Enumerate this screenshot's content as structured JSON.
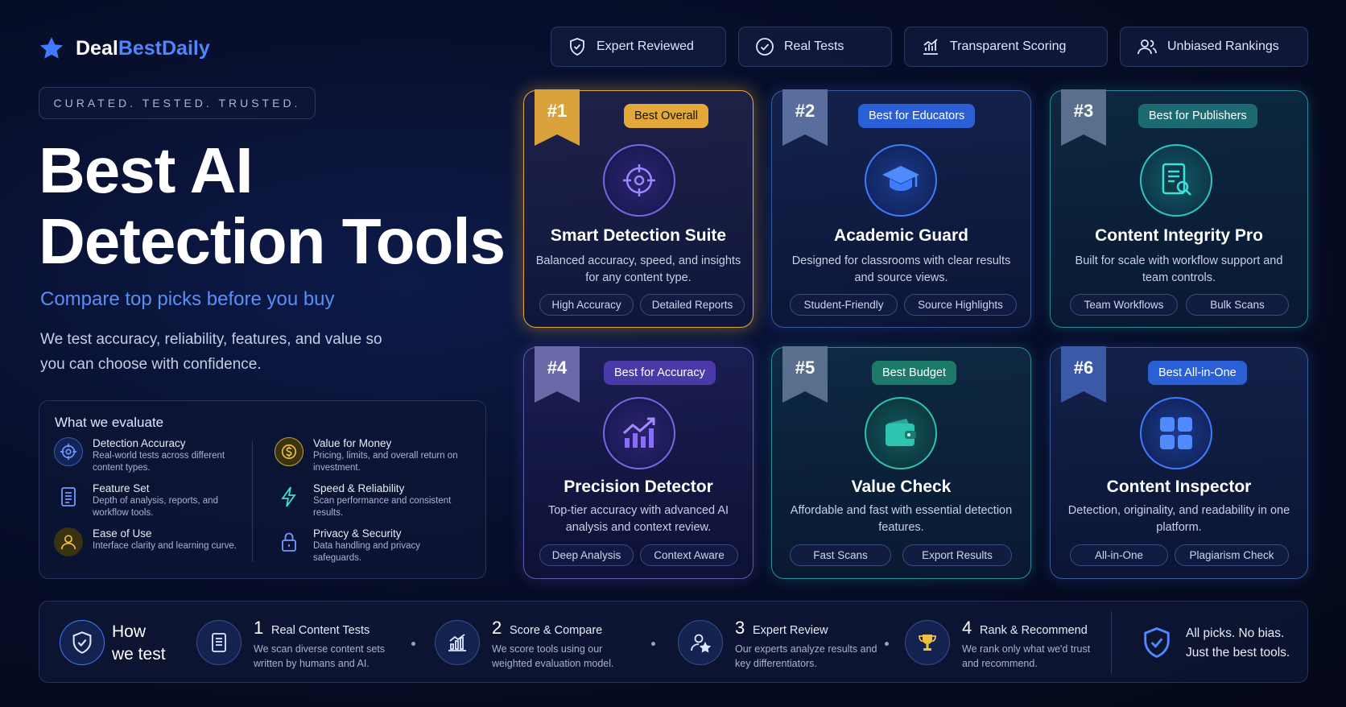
{
  "brand": {
    "name_part1": "Deal",
    "name_part2": "BestDaily",
    "icon": "star-icon"
  },
  "top_buttons": [
    {
      "label": "Expert Reviewed",
      "icon": "shield-check-icon"
    },
    {
      "label": "Real Tests",
      "icon": "check-circle-icon"
    },
    {
      "label": "Transparent Scoring",
      "icon": "bar-chart-icon"
    },
    {
      "label": "Unbiased Rankings",
      "icon": "users-icon"
    }
  ],
  "tagline": "CURATED. TESTED. TRUSTED.",
  "headline": "Best AI\nDetection Tools",
  "subheadline": "Compare top picks before you buy",
  "description": "We test accuracy, reliability, features, and value so you can choose with confidence.",
  "evaluate": {
    "title": "What we evaluate",
    "items": [
      {
        "title": "Detection Accuracy",
        "desc": "Real-world tests across different content types.",
        "icon": "target-icon"
      },
      {
        "title": "Feature Set",
        "desc": "Depth of analysis, reports, and workflow tools.",
        "icon": "document-icon"
      },
      {
        "title": "Ease of Use",
        "desc": "Interface clarity and learning curve.",
        "icon": "user-icon"
      },
      {
        "title": "Value for Money",
        "desc": "Pricing, limits, and overall return on investment.",
        "icon": "dollar-icon"
      },
      {
        "title": "Speed & Reliability",
        "desc": "Scan performance and consistent results.",
        "icon": "lightning-icon"
      },
      {
        "title": "Privacy & Security",
        "desc": "Data handling and privacy safeguards.",
        "icon": "lock-icon"
      }
    ]
  },
  "cards": [
    {
      "rank": "#1",
      "badge": "Best Overall",
      "name": "Smart Detection Suite",
      "desc": "Balanced accuracy, speed, and insights for any content type.",
      "tags": [
        "High Accuracy",
        "Detailed Reports"
      ],
      "icon": "crosshair-icon",
      "accent": "#e0a93a"
    },
    {
      "rank": "#2",
      "badge": "Best for Educators",
      "name": "Academic Guard",
      "desc": "Designed for classrooms with clear results and source views.",
      "tags": [
        "Student-Friendly",
        "Source Highlights"
      ],
      "icon": "graduation-cap-icon",
      "accent": "#3f7bff"
    },
    {
      "rank": "#3",
      "badge": "Best for Publishers",
      "name": "Content Integrity Pro",
      "desc": "Built for scale with workflow support and team controls.",
      "tags": [
        "Team Workflows",
        "Bulk Scans"
      ],
      "icon": "document-search-icon",
      "accent": "#2ec4c4"
    },
    {
      "rank": "#4",
      "badge": "Best for Accuracy",
      "name": "Precision Detector",
      "desc": "Top-tier accuracy with advanced AI analysis and context review.",
      "tags": [
        "Deep Analysis",
        "Context Aware"
      ],
      "icon": "chart-growth-icon",
      "accent": "#8a6cff"
    },
    {
      "rank": "#5",
      "badge": "Best Budget",
      "name": "Value Check",
      "desc": "Affordable and fast with essential detection features.",
      "tags": [
        "Fast Scans",
        "Export Results"
      ],
      "icon": "wallet-icon",
      "accent": "#2ec4a8"
    },
    {
      "rank": "#6",
      "badge": "Best All-in-One",
      "name": "Content Inspector",
      "desc": "Detection, originality, and readability in one platform.",
      "tags": [
        "All-in-One",
        "Plagiarism Check"
      ],
      "icon": "grid-icon",
      "accent": "#3f7bff"
    }
  ],
  "how": {
    "title_line1": "How",
    "title_line2": "we test",
    "steps": [
      {
        "num": "1",
        "title": "Real Content Tests",
        "desc": "We scan diverse content sets written by humans and AI.",
        "icon": "document-icon"
      },
      {
        "num": "2",
        "title": "Score & Compare",
        "desc": "We score tools using our weighted evaluation model.",
        "icon": "bar-chart-icon"
      },
      {
        "num": "3",
        "title": "Expert Review",
        "desc": "Our experts analyze results and key differentiators.",
        "icon": "user-star-icon"
      },
      {
        "num": "4",
        "title": "Rank & Recommend",
        "desc": "We rank only what we'd trust and recommend.",
        "icon": "trophy-icon"
      }
    ],
    "closing_line1": "All picks. No bias.",
    "closing_line2": "Just the best tools."
  }
}
